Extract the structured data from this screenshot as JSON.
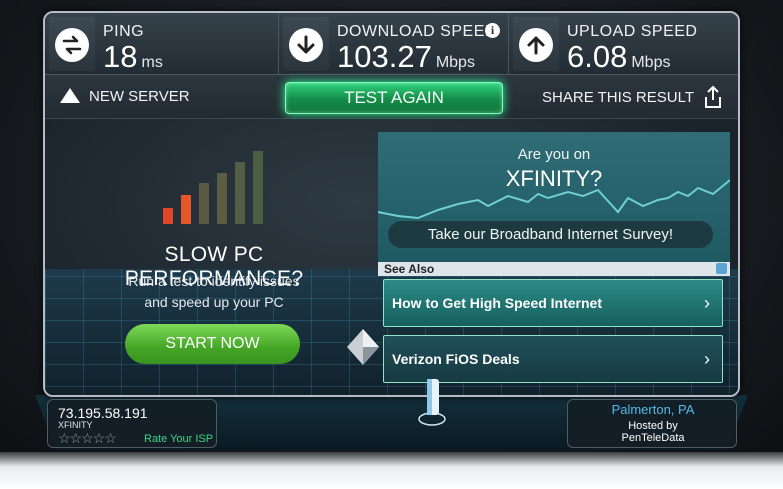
{
  "stats": {
    "ping": {
      "label": "PING",
      "value": "18",
      "unit": "ms",
      "icon": "exchange-arrows-icon"
    },
    "download": {
      "label": "DOWNLOAD SPEED",
      "value": "103.27",
      "unit": "Mbps",
      "icon": "download-arrow-icon"
    },
    "upload": {
      "label": "UPLOAD SPEED",
      "value": "6.08",
      "unit": "Mbps",
      "icon": "upload-arrow-icon"
    },
    "info": "i"
  },
  "toolbar": {
    "new_server": "NEW SERVER",
    "test_again": "TEST AGAIN",
    "share": "SHARE THIS RESULT"
  },
  "promo": {
    "title": "SLOW PC PERFORMANCE?",
    "line1": "Run a test to identify issues",
    "line2": "and speed up your PC",
    "button": "START NOW"
  },
  "ad": {
    "question": "Are you on",
    "brand": "XFINITY?",
    "survey": "Take our Broadband Internet Survey!",
    "see_also": "See Also",
    "links": [
      "How to Get High Speed Internet",
      "Verizon FiOS Deals"
    ]
  },
  "client": {
    "ip": "73.195.58.191",
    "isp": "XFINITY",
    "stars": "☆☆☆☆☆",
    "rate": "Rate Your ISP"
  },
  "server": {
    "city": "Palmerton, PA",
    "hosted_by": "Hosted by",
    "host": "PenTeleData"
  },
  "colors": {
    "accent_green": "#2bff98",
    "start_green": "#44a526",
    "city_blue": "#56b8e6"
  }
}
